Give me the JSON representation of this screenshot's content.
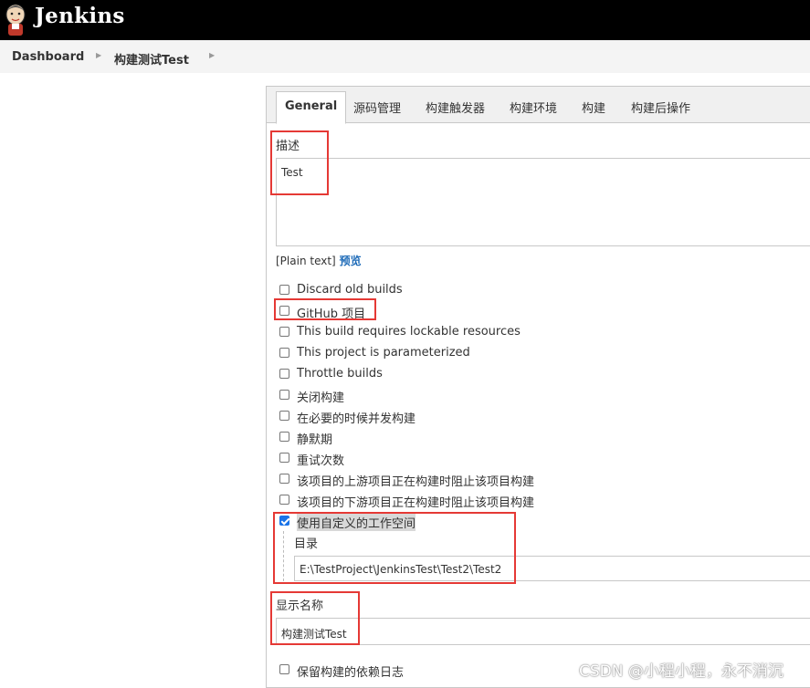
{
  "header": {
    "brand": "Jenkins"
  },
  "breadcrumb": {
    "items": [
      "Dashboard",
      "构建测试Test"
    ]
  },
  "tabs": [
    "General",
    "源码管理",
    "构建触发器",
    "构建环境",
    "构建",
    "构建后操作"
  ],
  "description": {
    "label": "描述",
    "value": "Test"
  },
  "plain_text": {
    "prefix": "[Plain text]",
    "preview": "预览"
  },
  "options": [
    {
      "label": "Discard old builds",
      "checked": false
    },
    {
      "label": "GitHub 项目",
      "checked": false
    },
    {
      "label": "This build requires lockable resources",
      "checked": false
    },
    {
      "label": "This project is parameterized",
      "checked": false
    },
    {
      "label": "Throttle builds",
      "checked": false
    },
    {
      "label": "关闭构建",
      "checked": false
    },
    {
      "label": "在必要的时候并发构建",
      "checked": false
    },
    {
      "label": "静默期",
      "checked": false
    },
    {
      "label": "重试次数",
      "checked": false
    },
    {
      "label": "该项目的上游项目正在构建时阻止该项目构建",
      "checked": false
    },
    {
      "label": "该项目的下游项目正在构建时阻止该项目构建",
      "checked": false
    },
    {
      "label": "使用自定义的工作空间",
      "checked": true
    }
  ],
  "workspace": {
    "label": "目录",
    "value": "E:\\TestProject\\JenkinsTest\\Test2\\Test2"
  },
  "display_name": {
    "label": "显示名称",
    "value": "构建测试Test"
  },
  "last_option": {
    "label": "保留构建的依赖日志",
    "checked": false
  },
  "watermark": "CSDN @小程小程，永不消沉",
  "colors": {
    "highlight": "#e53935",
    "link": "#1e6bb8",
    "checkbox_checked": "#1a73e8"
  }
}
